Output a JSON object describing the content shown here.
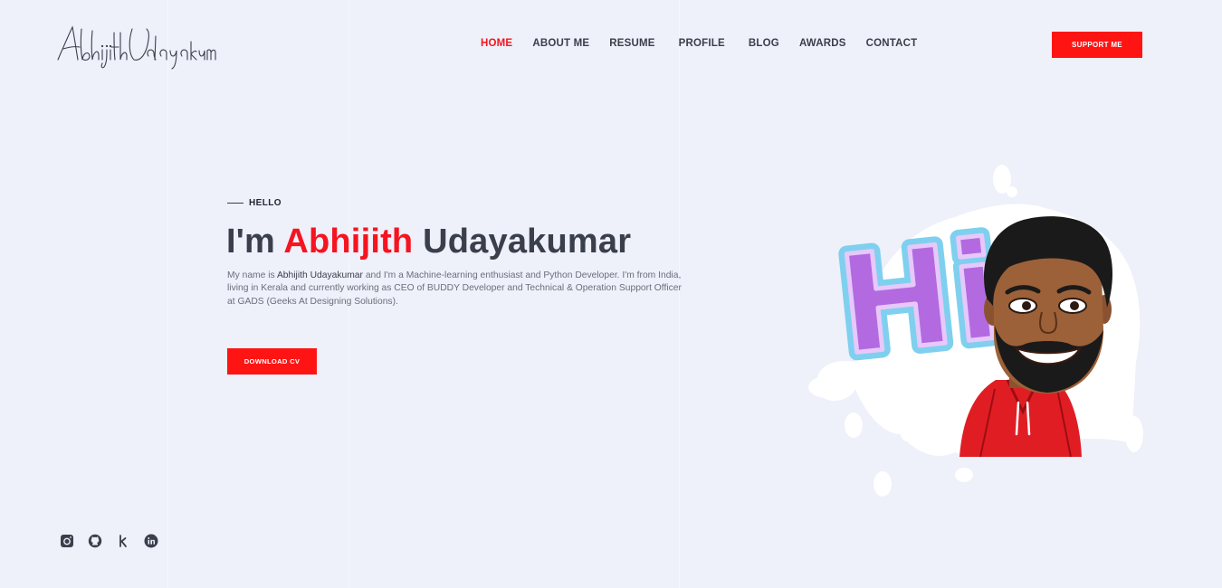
{
  "brand": {
    "logo_text": "Abhijith Udayakumar"
  },
  "nav": {
    "items": [
      {
        "label": "HOME",
        "active": true
      },
      {
        "label": "ABOUT ME",
        "active": false
      },
      {
        "label": "RESUME",
        "active": false
      },
      {
        "label": "PROFILE",
        "active": false
      },
      {
        "label": "BLOG",
        "active": false
      },
      {
        "label": "AWARDS",
        "active": false
      },
      {
        "label": "CONTACT",
        "active": false
      }
    ],
    "support_label": "SUPPORT ME"
  },
  "hero": {
    "eyebrow": "HELLO",
    "title_prefix": "I'm ",
    "title_name": "Abhijith",
    "title_suffix": " Udayakumar",
    "desc_1": "My name is ",
    "desc_name": "Abhijith Udayakumar",
    "desc_2": " and I'm a Machine-learning enthusiast and Python Developer. I'm from India, living in Kerala and currently working as CEO of BUDDY Developer and Technical & Operation Support Officer at GADS (Geeks At Designing Solutions).",
    "download_label": "DOWNLOAD CV",
    "sticker_text": "Hi"
  },
  "social": [
    {
      "icon": "instagram-icon"
    },
    {
      "icon": "github-icon"
    },
    {
      "icon": "kaggle-icon"
    },
    {
      "icon": "linkedin-icon"
    }
  ],
  "colors": {
    "accent": "#ff1414",
    "background": "#eef0fa",
    "text": "#3a3f4c"
  }
}
